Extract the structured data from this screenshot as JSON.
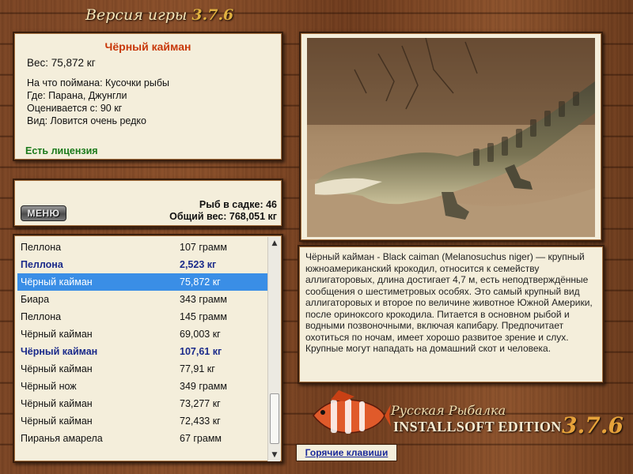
{
  "header": {
    "version_label": "Версия игры",
    "version_number": "3.7.6"
  },
  "fish_card": {
    "name": "Чёрный кайман",
    "weight": "Вес: 75,872 кг",
    "lines": [
      "На что поймана: Кусочки рыбы",
      "Где: Парана, Джунгли",
      "Оценивается с: 90 кг",
      "Вид: Ловится очень редко"
    ],
    "license": "Есть лицензия",
    "name_color": "#c8380a",
    "license_color": "#1b7a1b"
  },
  "stats": {
    "menu_label": "МЕНЮ",
    "fish_in_keepnet": "Рыб в садке: 46",
    "total_weight": "Общий вес: 768,051 кг"
  },
  "catch_list": [
    {
      "name": "Пеллона",
      "weight": "107 грамм",
      "style": "normal"
    },
    {
      "name": "Пеллона",
      "weight": "2,523 кг",
      "style": "bold"
    },
    {
      "name": "Чёрный кайман",
      "weight": "75,872 кг",
      "style": "selected"
    },
    {
      "name": "Биара",
      "weight": "343 грамм",
      "style": "normal"
    },
    {
      "name": "Пеллона",
      "weight": "145 грамм",
      "style": "normal"
    },
    {
      "name": "Чёрный кайман",
      "weight": "69,003 кг",
      "style": "normal"
    },
    {
      "name": "Чёрный кайман",
      "weight": "107,61 кг",
      "style": "bold"
    },
    {
      "name": "Чёрный кайман",
      "weight": "77,91 кг",
      "style": "normal"
    },
    {
      "name": "Чёрный нож",
      "weight": "349 грамм",
      "style": "normal"
    },
    {
      "name": "Чёрный кайман",
      "weight": "73,277 кг",
      "style": "normal"
    },
    {
      "name": "Чёрный кайман",
      "weight": "72,433 кг",
      "style": "normal"
    },
    {
      "name": "Пиранья амарела",
      "weight": "67 грамм",
      "style": "normal"
    }
  ],
  "description": "Чёрный кайман - Black caiman (Melanosuchus niger) — крупный южноамериканский крокодил, относится к семейству аллигаторовых, длина достигает 4,7 м, есть неподтверждённые сообщения о шестиметровых особях. Это самый крупный вид аллигаторовых и второе по величине животное Южной Америки, после ориноксого крокодила. Питается в основном рыбой и водными позвоночными, включая капибару. Предпочитает охотиться по ночам, имеет хорошо развитое зрение и слух. Крупные могут нападать на домашний скот и человека.",
  "edition": {
    "subtitle": "Русская Рыбалка",
    "title": "INSTALLSOFT EDITION",
    "number": "3.7.6"
  },
  "hotkeys_label": "Горячие клавиши",
  "colors": {
    "selection": "#3a8ee6",
    "bold_row": "#1a2a8a",
    "link": "#1a2a9a",
    "wood": "#7a4424"
  }
}
